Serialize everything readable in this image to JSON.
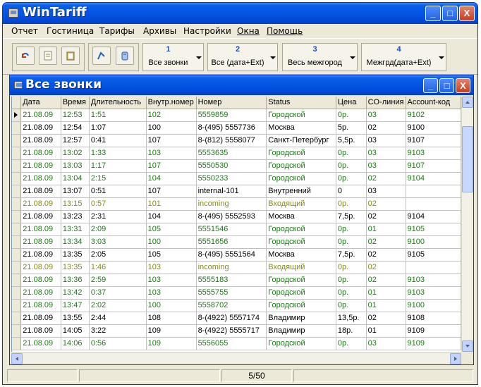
{
  "app": {
    "title": "WinTariff",
    "min": "_",
    "max": "□",
    "close": "X"
  },
  "menu": [
    {
      "label": "Отчет",
      "underline": false
    },
    {
      "label": "Гостиница",
      "underline": false
    },
    {
      "label": "Тарифы",
      "underline": false
    },
    {
      "label": "Архивы",
      "underline": false
    },
    {
      "label": "Настройки",
      "underline": false
    },
    {
      "label": "Окна",
      "underline": true
    },
    {
      "label": "Помощь",
      "underline": true
    }
  ],
  "toolbar": {
    "icons": [
      "refresh-icon",
      "document-icon",
      "clipboard-icon",
      "dial-icon",
      "phone-icon"
    ],
    "buttons": [
      {
        "num": "1",
        "label": "Все звонки"
      },
      {
        "num": "2",
        "label": "Все (дата+Ext)"
      },
      {
        "num": "3",
        "label": "Весь межгород"
      },
      {
        "num": "4",
        "label": "Межгрд(дата+Ext)"
      }
    ]
  },
  "child": {
    "title": "Все звонки"
  },
  "table": {
    "columns": [
      "Дата",
      "Время",
      "Длительность",
      "Внутр.номер",
      "Номер",
      "Status",
      "Цена",
      "CO-линия",
      "Account-код"
    ],
    "rows": [
      {
        "style": "green",
        "cells": [
          "21.08.09",
          "12:53",
          "1:51",
          "102",
          "5559859",
          "Городской",
          "0р.",
          "03",
          "9102"
        ]
      },
      {
        "style": "black",
        "cells": [
          "21.08.09",
          "12:54",
          "1:07",
          "100",
          "8-(495) 5557736",
          "Москва",
          "5р.",
          "02",
          "9100"
        ]
      },
      {
        "style": "black",
        "cells": [
          "21.08.09",
          "12:57",
          "0:41",
          "107",
          "8-(812) 5558077",
          "Санкт-Петербург",
          "5,5р.",
          "03",
          "9107"
        ]
      },
      {
        "style": "green",
        "cells": [
          "21.08.09",
          "13:02",
          "1:33",
          "103",
          "5553635",
          "Городской",
          "0р.",
          "03",
          "9103"
        ]
      },
      {
        "style": "green",
        "cells": [
          "21.08.09",
          "13:03",
          "1:17",
          "107",
          "5550530",
          "Городской",
          "0р.",
          "03",
          "9107"
        ]
      },
      {
        "style": "green",
        "cells": [
          "21.08.09",
          "13:04",
          "2:15",
          "104",
          "5550233",
          "Городской",
          "0р.",
          "02",
          "9104"
        ]
      },
      {
        "style": "black",
        "cells": [
          "21.08.09",
          "13:07",
          "0:51",
          "107",
          "internal-101",
          "Внутренний",
          "0",
          "03",
          ""
        ]
      },
      {
        "style": "olive",
        "cells": [
          "21.08.09",
          "13:15",
          "0:57",
          "101",
          "incoming",
          "Входящий",
          "0р.",
          "02",
          ""
        ]
      },
      {
        "style": "black",
        "cells": [
          "21.08.09",
          "13:23",
          "2:31",
          "104",
          "8-(495) 5552593",
          "Москва",
          "7,5р.",
          "02",
          "9104"
        ]
      },
      {
        "style": "green",
        "cells": [
          "21.08.09",
          "13:31",
          "2:09",
          "105",
          "5551546",
          "Городской",
          "0р.",
          "01",
          "9105"
        ]
      },
      {
        "style": "green",
        "cells": [
          "21.08.09",
          "13:34",
          "3:03",
          "100",
          "5551656",
          "Городской",
          "0р.",
          "02",
          "9100"
        ]
      },
      {
        "style": "black",
        "cells": [
          "21.08.09",
          "13:35",
          "2:05",
          "105",
          "8-(495) 5551564",
          "Москва",
          "7,5р.",
          "02",
          "9105"
        ]
      },
      {
        "style": "olive",
        "cells": [
          "21.08.09",
          "13:35",
          "1:46",
          "103",
          "incoming",
          "Входящий",
          "0р.",
          "02",
          ""
        ]
      },
      {
        "style": "green",
        "cells": [
          "21.08.09",
          "13:36",
          "2:59",
          "103",
          "5555183",
          "Городской",
          "0р.",
          "02",
          "9103"
        ]
      },
      {
        "style": "green",
        "cells": [
          "21.08.09",
          "13:42",
          "0:37",
          "103",
          "5555755",
          "Городской",
          "0р.",
          "01",
          "9103"
        ]
      },
      {
        "style": "green",
        "cells": [
          "21.08.09",
          "13:47",
          "2:02",
          "100",
          "5558702",
          "Городской",
          "0р.",
          "01",
          "9100"
        ]
      },
      {
        "style": "black",
        "cells": [
          "21.08.09",
          "13:55",
          "2:44",
          "108",
          "8-(4922) 5557174",
          "Владимир",
          "13,5р.",
          "02",
          "9108"
        ]
      },
      {
        "style": "black",
        "cells": [
          "21.08.09",
          "14:05",
          "3:22",
          "109",
          "8-(4922) 5555717",
          "Владимир",
          "18р.",
          "01",
          "9109"
        ]
      },
      {
        "style": "green",
        "cells": [
          "21.08.09",
          "14:06",
          "0:56",
          "109",
          "5556055",
          "Городской",
          "0р.",
          "03",
          "9109"
        ]
      }
    ]
  },
  "status": {
    "position": "5/50"
  }
}
